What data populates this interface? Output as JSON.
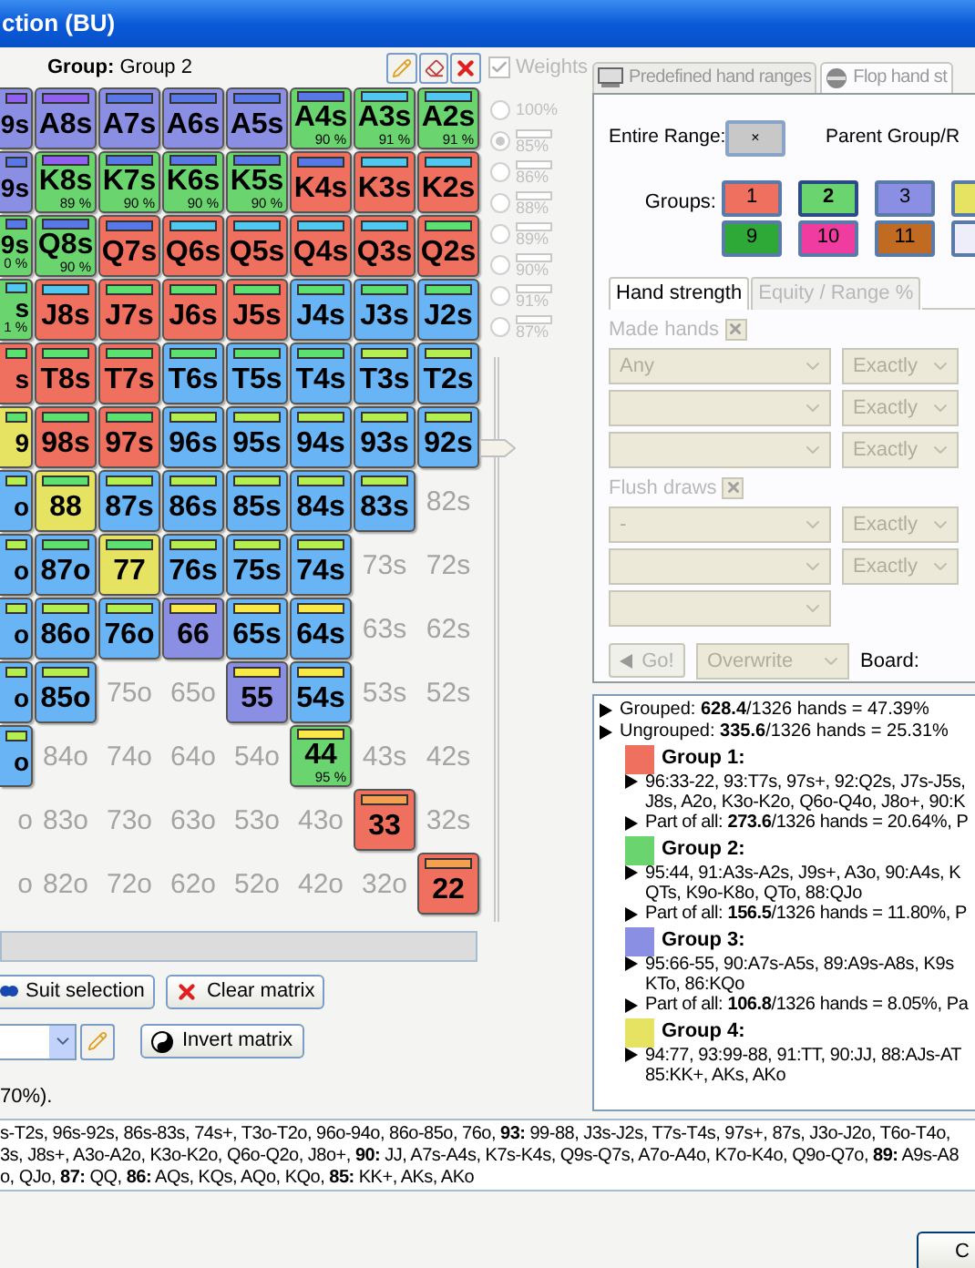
{
  "window": {
    "title": "ction (BU)"
  },
  "group_label": "**Group:** Group 2",
  "weights": {
    "label": "Weights",
    "checked": true,
    "disabled": true,
    "options": [
      {
        "label": "100%",
        "selected": false,
        "bar": false
      },
      {
        "label": "85%",
        "selected": true,
        "bar": true
      },
      {
        "label": "86%",
        "selected": false,
        "bar": true
      },
      {
        "label": "88%",
        "selected": false,
        "bar": true
      },
      {
        "label": "89%",
        "selected": false,
        "bar": true
      },
      {
        "label": "90%",
        "selected": false,
        "bar": true
      },
      {
        "label": "91%",
        "selected": false,
        "bar": true
      },
      {
        "label": "87%",
        "selected": false,
        "bar": true
      }
    ]
  },
  "weight_slider": {
    "level": 0.85
  },
  "matrix": {
    "rows": [
      {
        "cells": [
          {
            "label": "9s",
            "color": "#8a8fe4",
            "bar": {
              "color": "#9060f0"
            }
          },
          {
            "label": "A8s",
            "color": "#8a8fe4",
            "bar": {
              "color": "#9060f0"
            }
          },
          {
            "label": "A7s",
            "color": "#8a8fe4",
            "bar": {
              "color": "#5878e8"
            }
          },
          {
            "label": "A6s",
            "color": "#8a8fe4",
            "bar": {
              "color": "#5878e8"
            }
          },
          {
            "label": "A5s",
            "color": "#8a8fe4",
            "bar": {
              "color": "#5878e8"
            }
          },
          {
            "label": "A4s",
            "color": "#6ad56e",
            "bar": {
              "color": "#5878e8"
            },
            "weight": "90 %"
          },
          {
            "label": "A3s",
            "color": "#6ad56e",
            "bar": {
              "color": "#50c8f0"
            },
            "weight": "91 %"
          },
          {
            "label": "A2s",
            "color": "#6ad56e",
            "bar": {
              "color": "#50c8f0"
            },
            "weight": "91 %"
          }
        ]
      },
      {
        "cells": [
          {
            "label": "9s",
            "color": "#8a8fe4",
            "bar": {
              "color": "#5878e8"
            }
          },
          {
            "label": "K8s",
            "color": "#6ad56e",
            "bar": {
              "color": "#9060f0"
            },
            "weight": "89 %"
          },
          {
            "label": "K7s",
            "color": "#6ad56e",
            "bar": {
              "color": "#5878e8"
            },
            "weight": "90 %"
          },
          {
            "label": "K6s",
            "color": "#6ad56e",
            "bar": {
              "color": "#5878e8"
            },
            "weight": "90 %"
          },
          {
            "label": "K5s",
            "color": "#6ad56e",
            "bar": {
              "color": "#5878e8"
            },
            "weight": "90 %"
          },
          {
            "label": "K4s",
            "color": "#f0705f",
            "bar": {
              "color": "#5878e8"
            }
          },
          {
            "label": "K3s",
            "color": "#f0705f",
            "bar": {
              "color": "#50c8f0"
            }
          },
          {
            "label": "K2s",
            "color": "#f0705f",
            "bar": {
              "color": "#50c8f0"
            }
          }
        ]
      },
      {
        "cells": [
          {
            "label": "9s",
            "color": "#6ad56e",
            "bar": {
              "color": "#5878e8"
            },
            "weight": "0 %"
          },
          {
            "label": "Q8s",
            "color": "#6ad56e",
            "bar": {
              "color": "#5878e8"
            },
            "weight": "90 %"
          },
          {
            "label": "Q7s",
            "color": "#f0705f",
            "bar": {
              "color": "#5878e8"
            }
          },
          {
            "label": "Q6s",
            "color": "#f0705f",
            "bar": {
              "color": "#50c8f0"
            }
          },
          {
            "label": "Q5s",
            "color": "#f0705f",
            "bar": {
              "color": "#50c8f0"
            }
          },
          {
            "label": "Q4s",
            "color": "#f0705f",
            "bar": {
              "color": "#50c8f0"
            }
          },
          {
            "label": "Q3s",
            "color": "#f0705f",
            "bar": {
              "color": "#50c8f0"
            }
          },
          {
            "label": "Q2s",
            "color": "#f0705f",
            "bar": {
              "color": "#5ce070"
            }
          }
        ]
      },
      {
        "cells": [
          {
            "label": "s",
            "color": "#6ad56e",
            "bar": {
              "color": "#50c8f0"
            },
            "weight": "1 %"
          },
          {
            "label": "J8s",
            "color": "#f0705f",
            "bar": {
              "color": "#50c8f0"
            }
          },
          {
            "label": "J7s",
            "color": "#f0705f",
            "bar": {
              "color": "#5ce070"
            }
          },
          {
            "label": "J6s",
            "color": "#f0705f",
            "bar": {
              "color": "#5ce070"
            }
          },
          {
            "label": "J5s",
            "color": "#f0705f",
            "bar": {
              "color": "#5ce070"
            }
          },
          {
            "label": "J4s",
            "color": "#68b4f4",
            "bar": {
              "color": "#5ce070"
            }
          },
          {
            "label": "J3s",
            "color": "#68b4f4",
            "bar": {
              "color": "#5ce070"
            }
          },
          {
            "label": "J2s",
            "color": "#68b4f4",
            "bar": {
              "color": "#5ce070"
            }
          }
        ]
      },
      {
        "cells": [
          {
            "label": "s",
            "color": "#f0705f",
            "bar": {
              "color": "#5ce070"
            }
          },
          {
            "label": "T8s",
            "color": "#f0705f",
            "bar": {
              "color": "#5ce070"
            }
          },
          {
            "label": "T7s",
            "color": "#f0705f",
            "bar": {
              "color": "#5ce070"
            }
          },
          {
            "label": "T6s",
            "color": "#68b4f4",
            "bar": {
              "color": "#5ce070"
            }
          },
          {
            "label": "T5s",
            "color": "#68b4f4",
            "bar": {
              "color": "#5ce070"
            }
          },
          {
            "label": "T4s",
            "color": "#68b4f4",
            "bar": {
              "color": "#5ce070"
            }
          },
          {
            "label": "T3s",
            "color": "#68b4f4",
            "bar": {
              "color": "#b4ee50"
            }
          },
          {
            "label": "T2s",
            "color": "#68b4f4",
            "bar": {
              "color": "#b4ee50"
            }
          }
        ]
      },
      {
        "cells": [
          {
            "label": "9",
            "color": "#e6e362",
            "bar": {
              "color": "#5ce070"
            }
          },
          {
            "label": "98s",
            "color": "#f0705f",
            "bar": {
              "color": "#5ce070"
            }
          },
          {
            "label": "97s",
            "color": "#f0705f",
            "bar": {
              "color": "#5ce070"
            }
          },
          {
            "label": "96s",
            "color": "#68b4f4",
            "bar": {
              "color": "#b4ee50"
            }
          },
          {
            "label": "95s",
            "color": "#68b4f4",
            "bar": {
              "color": "#b4ee50"
            }
          },
          {
            "label": "94s",
            "color": "#68b4f4",
            "bar": {
              "color": "#b4ee50"
            }
          },
          {
            "label": "93s",
            "color": "#68b4f4",
            "bar": {
              "color": "#b4ee50"
            }
          },
          {
            "label": "92s",
            "color": "#68b4f4",
            "bar": {
              "color": "#b4ee50"
            }
          }
        ]
      },
      {
        "cells": [
          {
            "label": "o",
            "color": "#68b4f4",
            "bar": {
              "color": "#b4ee50"
            }
          },
          {
            "label": "88",
            "color": "#e6e362",
            "bar": {
              "color": "#5ce070"
            }
          },
          {
            "label": "87s",
            "color": "#68b4f4",
            "bar": {
              "color": "#b4ee50"
            }
          },
          {
            "label": "86s",
            "color": "#68b4f4",
            "bar": {
              "color": "#b4ee50"
            }
          },
          {
            "label": "85s",
            "color": "#68b4f4",
            "bar": {
              "color": "#b4ee50"
            }
          },
          {
            "label": "84s",
            "color": "#68b4f4",
            "bar": {
              "color": "#b4ee50"
            }
          },
          {
            "label": "83s",
            "color": "#68b4f4",
            "bar": {
              "color": "#b4ee50"
            }
          },
          {
            "label": "82s"
          }
        ]
      },
      {
        "cells": [
          {
            "label": "o",
            "color": "#68b4f4",
            "bar": {
              "color": "#b4ee50"
            }
          },
          {
            "label": "87o",
            "color": "#68b4f4",
            "bar": {
              "color": "#5ce070"
            }
          },
          {
            "label": "77",
            "color": "#e6e362",
            "bar": {
              "color": "#5ce070"
            }
          },
          {
            "label": "76s",
            "color": "#68b4f4",
            "bar": {
              "color": "#b4ee50"
            }
          },
          {
            "label": "75s",
            "color": "#68b4f4",
            "bar": {
              "color": "#b4ee50"
            }
          },
          {
            "label": "74s",
            "color": "#68b4f4",
            "bar": {
              "color": "#b4ee50"
            }
          },
          {
            "label": "73s"
          },
          {
            "label": "72s"
          }
        ]
      },
      {
        "cells": [
          {
            "label": "o",
            "color": "#68b4f4",
            "bar": {
              "color": "#b4ee50"
            }
          },
          {
            "label": "86o",
            "color": "#68b4f4",
            "bar": {
              "color": "#b4ee50"
            }
          },
          {
            "label": "76o",
            "color": "#68b4f4",
            "bar": {
              "color": "#b4ee50"
            }
          },
          {
            "label": "66",
            "color": "#8a8fe4",
            "bar": {
              "color": "#f8e848"
            }
          },
          {
            "label": "65s",
            "color": "#68b4f4",
            "bar": {
              "color": "#f8e848"
            }
          },
          {
            "label": "64s",
            "color": "#68b4f4",
            "bar": {
              "color": "#f8e848"
            }
          },
          {
            "label": "63s"
          },
          {
            "label": "62s"
          }
        ]
      },
      {
        "cells": [
          {
            "label": "o",
            "color": "#68b4f4",
            "bar": {
              "color": "#b4ee50"
            }
          },
          {
            "label": "85o",
            "color": "#68b4f4",
            "bar": {
              "color": "#b4ee50"
            }
          },
          {
            "label": "75o"
          },
          {
            "label": "65o"
          },
          {
            "label": "55",
            "color": "#8a8fe4",
            "bar": {
              "color": "#f8e848"
            }
          },
          {
            "label": "54s",
            "color": "#68b4f4",
            "bar": {
              "color": "#f8e848"
            }
          },
          {
            "label": "53s"
          },
          {
            "label": "52s"
          }
        ]
      },
      {
        "cells": [
          {
            "label": "o",
            "color": "#68b4f4",
            "bar": {
              "color": "#b4ee50"
            }
          },
          {
            "label": "84o"
          },
          {
            "label": "74o"
          },
          {
            "label": "64o"
          },
          {
            "label": "54o"
          },
          {
            "label": "44",
            "color": "#6ad56e",
            "bar": {
              "color": "#f8e848"
            },
            "weight": "95 %"
          },
          {
            "label": "43s"
          },
          {
            "label": "42s"
          }
        ]
      },
      {
        "cells": [
          {
            "label": "o"
          },
          {
            "label": "83o"
          },
          {
            "label": "73o"
          },
          {
            "label": "63o"
          },
          {
            "label": "53o"
          },
          {
            "label": "43o"
          },
          {
            "label": "33",
            "color": "#f0705f",
            "bar": {
              "color": "#f4a050"
            }
          },
          {
            "label": "32s"
          }
        ]
      },
      {
        "cells": [
          {
            "label": "o"
          },
          {
            "label": "82o"
          },
          {
            "label": "72o"
          },
          {
            "label": "62o"
          },
          {
            "label": "52o"
          },
          {
            "label": "42o"
          },
          {
            "label": "32o"
          },
          {
            "label": "22",
            "color": "#f0705f",
            "bar": {
              "color": "#f4a050"
            }
          }
        ]
      }
    ]
  },
  "matrix_buttons": [
    {
      "label": "Suit selection",
      "kind": "suit"
    },
    {
      "label": "Clear matrix",
      "kind": "clear"
    }
  ],
  "invert_button": "Invert matrix",
  "range_note": "70%).",
  "right_tabs": [
    {
      "label": "Predefined hand ranges",
      "selected": false,
      "kind": "hands"
    },
    {
      "label": "Flop hand st",
      "selected": true,
      "kind": "flop"
    }
  ],
  "entire_range": {
    "label": "Entire Range:",
    "button": "×"
  },
  "parent_group": "Parent Group/R",
  "groups": {
    "label": "Groups:",
    "items": [
      {
        "label": "1",
        "color": "#f0705f",
        "selected": false
      },
      {
        "label": "2",
        "color": "#6ad56e",
        "selected": true
      },
      {
        "label": "3",
        "color": "#8a8fe4",
        "selected": false
      },
      {
        "color": "#e6e362"
      },
      {
        "label": "9",
        "color": "#2ea836",
        "selected": false
      },
      {
        "label": "10",
        "color": "#f03ca0",
        "selected": false
      },
      {
        "label": "11",
        "color": "#c06a22",
        "selected": false
      },
      {
        "color": "#eeeefa"
      }
    ]
  },
  "strength_tabs": [
    {
      "label": "Hand strength",
      "selected": true
    },
    {
      "label": "Equity / Range %",
      "selected": false
    }
  ],
  "filters": {
    "disabled": true,
    "sections": [
      {
        "label": "Made hands",
        "rows": [
          {
            "kind": "pair",
            "hand": "Any",
            "mode": "Exactly"
          },
          {
            "kind": "pair",
            "mode": "Exactly"
          },
          {
            "kind": "pair",
            "mode": "Exactly"
          }
        ]
      },
      {
        "label": "Flush draws",
        "rows": [
          {
            "kind": "pair",
            "hand": "-",
            "mode": "Exactly"
          },
          {
            "kind": "pair",
            "mode": "Exactly"
          },
          {
            "kind": "single"
          }
        ]
      }
    ]
  },
  "go_button": "Go!",
  "write_mode": "Overwrite",
  "board_label": "Board:",
  "summary": {
    "totals": [
      "Grouped: **628.4**/1326 hands = 47.39%",
      "Ungrouped: **335.6**/1326 hands = 25.31%"
    ],
    "groups": [
      {
        "title": "Group 1:",
        "color": "#f0705f",
        "hands": [
          "96:33-22, 93:T7s, 97s+, 92:Q2s, J7s-J5s,",
          "J8s, A2o, K3o-K2o, Q6o-Q4o, J8o+, 90:K"
        ],
        "part": "Part of all: **273.6**/1326 hands = 20.64%, P"
      },
      {
        "title": "Group 2:",
        "color": "#6ad56e",
        "hands": [
          "95:44, 91:A3s-A2s, J9s+, A3o, 90:A4s, K",
          "QTs, K9o-K8o, QTo, 88:QJo"
        ],
        "part": "Part of all: **156.5**/1326 hands = 11.80%, P"
      },
      {
        "title": "Group 3:",
        "color": "#8a8fe4",
        "hands": [
          "95:66-55, 90:A7s-A5s, 89:A9s-A8s, K9s",
          "KTo, 86:KQo"
        ],
        "part": "Part of all: **106.8**/1326 hands = 8.05%, Pa"
      },
      {
        "title": "Group 4:",
        "color": "#e6e362",
        "hands": [
          "94:77, 93:99-88, 91:TT, 90:JJ, 88:AJs-AT",
          "85:KK+, AKs, AKo"
        ]
      }
    ]
  },
  "range_text": [
    "s-T2s, 96s-92s, 86s-83s, 74s+, T3o-T2o, 96o-94o, 86o-85o, 76o, **93:** 99-88, J3s-J2s, T7s-T4s, 97s+, 87s, J3o-J2o, T6o-T4o,",
    "3s, J8s+, A3o-A2o, K3o-K2o, Q6o-Q2o, J8o+, **90:** JJ, A7s-A4s, K7s-K4s, Q9s-Q7s, A7o-A4o, K7o-K4o, Q9o-Q7o, **89:** A9s-A8",
    "o, QJo, **87:** QQ, **86:** AQs, KQs, AQo, KQo, **85:** KK+, AKs, AKo"
  ],
  "ok_button": "C"
}
